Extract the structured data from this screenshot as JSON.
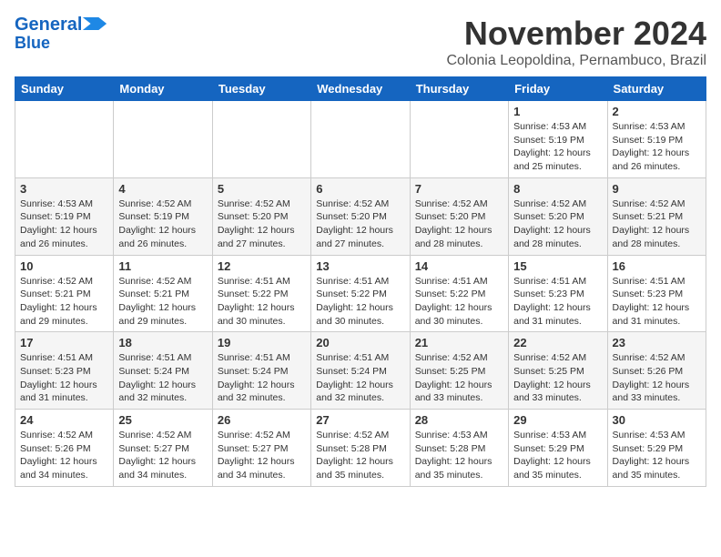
{
  "logo": {
    "line1": "General",
    "line2": "Blue"
  },
  "title": "November 2024",
  "location": "Colonia Leopoldina, Pernambuco, Brazil",
  "weekdays": [
    "Sunday",
    "Monday",
    "Tuesday",
    "Wednesday",
    "Thursday",
    "Friday",
    "Saturday"
  ],
  "weeks": [
    [
      {
        "day": "",
        "info": ""
      },
      {
        "day": "",
        "info": ""
      },
      {
        "day": "",
        "info": ""
      },
      {
        "day": "",
        "info": ""
      },
      {
        "day": "",
        "info": ""
      },
      {
        "day": "1",
        "info": "Sunrise: 4:53 AM\nSunset: 5:19 PM\nDaylight: 12 hours and 25 minutes."
      },
      {
        "day": "2",
        "info": "Sunrise: 4:53 AM\nSunset: 5:19 PM\nDaylight: 12 hours and 26 minutes."
      }
    ],
    [
      {
        "day": "3",
        "info": "Sunrise: 4:53 AM\nSunset: 5:19 PM\nDaylight: 12 hours and 26 minutes."
      },
      {
        "day": "4",
        "info": "Sunrise: 4:52 AM\nSunset: 5:19 PM\nDaylight: 12 hours and 26 minutes."
      },
      {
        "day": "5",
        "info": "Sunrise: 4:52 AM\nSunset: 5:20 PM\nDaylight: 12 hours and 27 minutes."
      },
      {
        "day": "6",
        "info": "Sunrise: 4:52 AM\nSunset: 5:20 PM\nDaylight: 12 hours and 27 minutes."
      },
      {
        "day": "7",
        "info": "Sunrise: 4:52 AM\nSunset: 5:20 PM\nDaylight: 12 hours and 28 minutes."
      },
      {
        "day": "8",
        "info": "Sunrise: 4:52 AM\nSunset: 5:20 PM\nDaylight: 12 hours and 28 minutes."
      },
      {
        "day": "9",
        "info": "Sunrise: 4:52 AM\nSunset: 5:21 PM\nDaylight: 12 hours and 28 minutes."
      }
    ],
    [
      {
        "day": "10",
        "info": "Sunrise: 4:52 AM\nSunset: 5:21 PM\nDaylight: 12 hours and 29 minutes."
      },
      {
        "day": "11",
        "info": "Sunrise: 4:52 AM\nSunset: 5:21 PM\nDaylight: 12 hours and 29 minutes."
      },
      {
        "day": "12",
        "info": "Sunrise: 4:51 AM\nSunset: 5:22 PM\nDaylight: 12 hours and 30 minutes."
      },
      {
        "day": "13",
        "info": "Sunrise: 4:51 AM\nSunset: 5:22 PM\nDaylight: 12 hours and 30 minutes."
      },
      {
        "day": "14",
        "info": "Sunrise: 4:51 AM\nSunset: 5:22 PM\nDaylight: 12 hours and 30 minutes."
      },
      {
        "day": "15",
        "info": "Sunrise: 4:51 AM\nSunset: 5:23 PM\nDaylight: 12 hours and 31 minutes."
      },
      {
        "day": "16",
        "info": "Sunrise: 4:51 AM\nSunset: 5:23 PM\nDaylight: 12 hours and 31 minutes."
      }
    ],
    [
      {
        "day": "17",
        "info": "Sunrise: 4:51 AM\nSunset: 5:23 PM\nDaylight: 12 hours and 31 minutes."
      },
      {
        "day": "18",
        "info": "Sunrise: 4:51 AM\nSunset: 5:24 PM\nDaylight: 12 hours and 32 minutes."
      },
      {
        "day": "19",
        "info": "Sunrise: 4:51 AM\nSunset: 5:24 PM\nDaylight: 12 hours and 32 minutes."
      },
      {
        "day": "20",
        "info": "Sunrise: 4:51 AM\nSunset: 5:24 PM\nDaylight: 12 hours and 32 minutes."
      },
      {
        "day": "21",
        "info": "Sunrise: 4:52 AM\nSunset: 5:25 PM\nDaylight: 12 hours and 33 minutes."
      },
      {
        "day": "22",
        "info": "Sunrise: 4:52 AM\nSunset: 5:25 PM\nDaylight: 12 hours and 33 minutes."
      },
      {
        "day": "23",
        "info": "Sunrise: 4:52 AM\nSunset: 5:26 PM\nDaylight: 12 hours and 33 minutes."
      }
    ],
    [
      {
        "day": "24",
        "info": "Sunrise: 4:52 AM\nSunset: 5:26 PM\nDaylight: 12 hours and 34 minutes."
      },
      {
        "day": "25",
        "info": "Sunrise: 4:52 AM\nSunset: 5:27 PM\nDaylight: 12 hours and 34 minutes."
      },
      {
        "day": "26",
        "info": "Sunrise: 4:52 AM\nSunset: 5:27 PM\nDaylight: 12 hours and 34 minutes."
      },
      {
        "day": "27",
        "info": "Sunrise: 4:52 AM\nSunset: 5:28 PM\nDaylight: 12 hours and 35 minutes."
      },
      {
        "day": "28",
        "info": "Sunrise: 4:53 AM\nSunset: 5:28 PM\nDaylight: 12 hours and 35 minutes."
      },
      {
        "day": "29",
        "info": "Sunrise: 4:53 AM\nSunset: 5:29 PM\nDaylight: 12 hours and 35 minutes."
      },
      {
        "day": "30",
        "info": "Sunrise: 4:53 AM\nSunset: 5:29 PM\nDaylight: 12 hours and 35 minutes."
      }
    ]
  ]
}
